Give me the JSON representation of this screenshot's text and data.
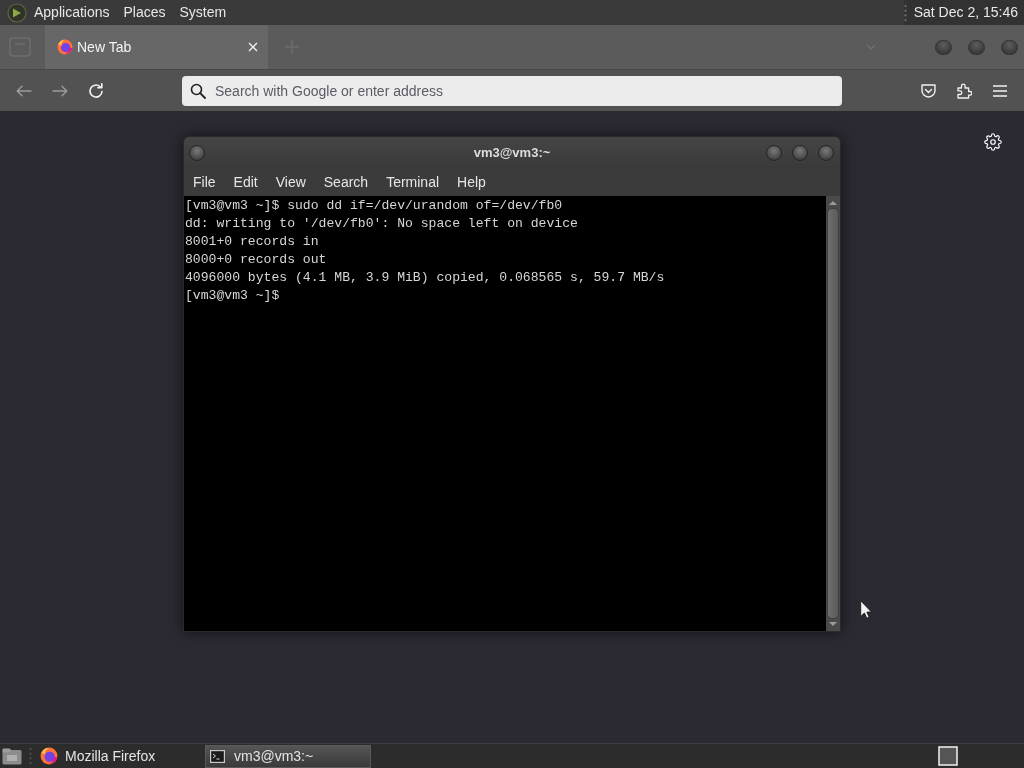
{
  "top_panel": {
    "menus": [
      "Applications",
      "Places",
      "System"
    ],
    "clock": "Sat Dec 2, 15:46"
  },
  "browser": {
    "tabs": [
      {
        "title": "New Tab",
        "selected": true
      }
    ],
    "navigation": {
      "back": {
        "disabled": true
      },
      "forward": {
        "disabled": true
      }
    },
    "address_bar": {
      "placeholder": "Search with Google or enter address"
    }
  },
  "terminal_window": {
    "title": "vm3@vm3:~",
    "menu": [
      "File",
      "Edit",
      "View",
      "Search",
      "Terminal",
      "Help"
    ],
    "lines": [
      "[vm3@vm3 ~]$ sudo dd if=/dev/urandom of=/dev/fb0",
      "dd: writing to '/dev/fb0': No space left on device",
      "8001+0 records in",
      "8000+0 records out",
      "4096000 bytes (4.1 MB, 3.9 MiB) copied, 0.068565 s, 59.7 MB/s",
      "[vm3@vm3 ~]$"
    ]
  },
  "taskbar": {
    "tasks": [
      {
        "kind": "browser",
        "title": "Mozilla Firefox",
        "selected": false
      },
      {
        "kind": "terminal",
        "title": "vm3@vm3:~",
        "selected": true
      }
    ]
  }
}
